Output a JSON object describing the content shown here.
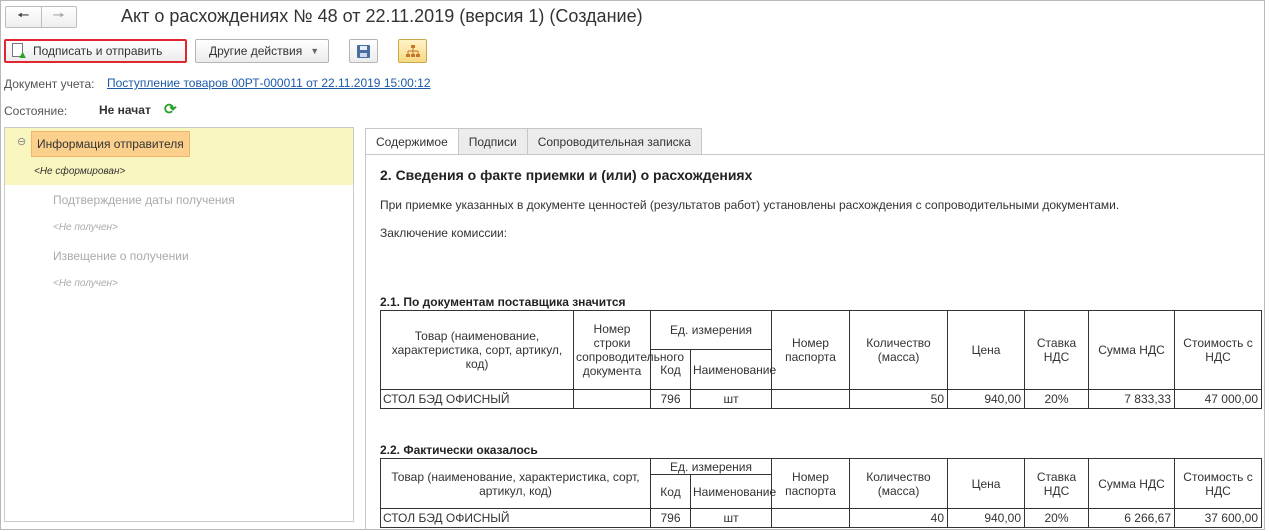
{
  "window": {
    "title": "Акт о расхождениях № 48 от 22.11.2019 (версия 1) (Создание)",
    "back_icon": "arrow-left-icon",
    "forward_icon": "arrow-right-icon"
  },
  "toolbar": {
    "sign_send_label": "Подписать и отправить",
    "other_actions_label": "Другие действия",
    "save_icon": "floppy-disk-icon",
    "structure_icon": "structure-icon",
    "highlight_color": "#e0262e"
  },
  "info": {
    "doc_label": "Документ учета:",
    "doc_link": "Поступление товаров 00РТ-000011 от 22.11.2019 15:00:12",
    "state_label": "Состояние:",
    "state_value": "Не начат"
  },
  "tree": {
    "items": [
      {
        "label": "Информация отправителя",
        "status": "<Не сформирован>",
        "active": true
      },
      {
        "label": "Подтверждение даты получения",
        "status": "<Не получен>",
        "active": false
      },
      {
        "label": "Извещение о получении",
        "status": "<Не получен>",
        "active": false
      }
    ]
  },
  "tabs": [
    "Содержимое",
    "Подписи",
    "Сопроводительная записка"
  ],
  "content": {
    "heading": "2. Сведения о факте приемки и (или) о расхождениях",
    "paragraph": "При приемке указанных в документе ценностей (результатов работ) установлены расхождения с сопроводительными документами.",
    "commission": "Заключение комиссии:",
    "section1": {
      "title": "2.1. По документам поставщика значится",
      "headers": {
        "product": "Товар (наименование, характеристика, сорт, артикул, код)",
        "row_no": "Номер строки сопроводительного документа",
        "unit": "Ед. измерения",
        "code": "Код",
        "name": "Наименование",
        "passport": "Номер паспорта",
        "qty": "Количество (масса)",
        "price": "Цена",
        "vat_rate": "Ставка НДС",
        "vat_sum": "Сумма НДС",
        "total": "Стоимость с НДС"
      },
      "rows": [
        {
          "product": "СТОЛ БЭД ОФИСНЫЙ",
          "row_no": "",
          "code": "796",
          "name": "шт",
          "passport": "",
          "qty": "50",
          "price": "940,00",
          "vat_rate": "20%",
          "vat_sum": "7 833,33",
          "total": "47 000,00"
        }
      ]
    },
    "section2": {
      "title": "2.2. Фактически оказалось",
      "headers": {
        "product": "Товар (наименование, характеристика, сорт, артикул, код)",
        "unit": "Ед. измерения",
        "code": "Код",
        "name": "Наименование",
        "passport": "Номер паспорта",
        "qty": "Количество (масса)",
        "price": "Цена",
        "vat_rate": "Ставка НДС",
        "vat_sum": "Сумма НДС",
        "total": "Стоимость с НДС"
      },
      "rows": [
        {
          "product": "СТОЛ БЭД ОФИСНЫЙ",
          "code": "796",
          "name": "шт",
          "passport": "",
          "qty": "40",
          "price": "940,00",
          "vat_rate": "20%",
          "vat_sum": "6 266,67",
          "total": "37 600,00"
        }
      ]
    }
  }
}
